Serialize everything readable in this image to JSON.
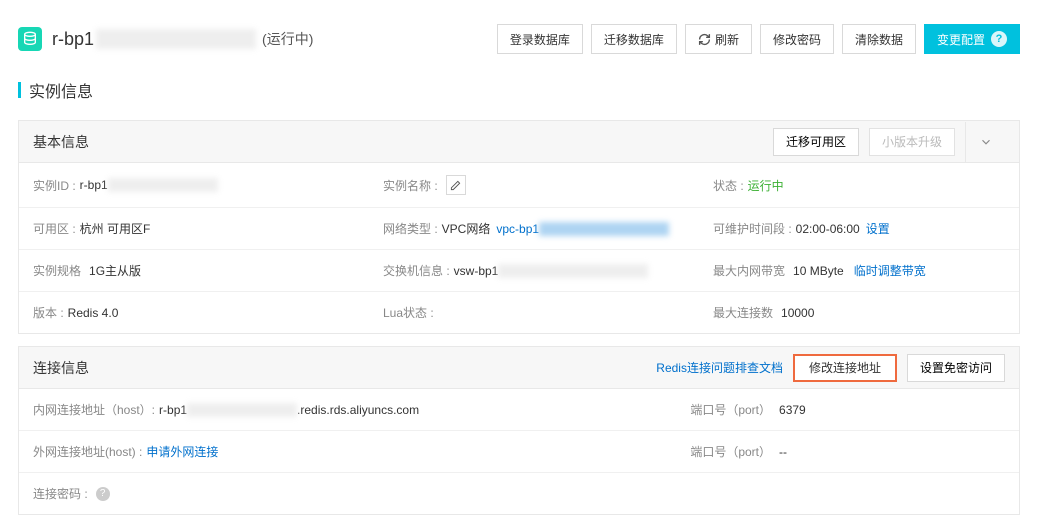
{
  "header": {
    "prefix": "r-bp1",
    "status": "(运行中)",
    "buttons": {
      "login_db": "登录数据库",
      "migrate_db": "迁移数据库",
      "refresh": "刷新",
      "change_pwd": "修改密码",
      "clear_data": "清除数据",
      "change_spec": "变更配置"
    }
  },
  "section": {
    "instance_info": "实例信息"
  },
  "basic": {
    "title": "基本信息",
    "migrate_zone": "迁移可用区",
    "minor_upgrade": "小版本升级",
    "instance_id_label": "实例ID :",
    "instance_id_prefix": "r-bp1",
    "instance_name_label": "实例名称 :",
    "status_label": "状态 :",
    "status_value": "运行中",
    "zone_label": "可用区 :",
    "zone_value": "杭州 可用区F",
    "net_type_label": "网络类型 :",
    "net_type_value": "VPC网络",
    "vpc_prefix": "vpc-bp1",
    "maint_label": "可维护时间段 :",
    "maint_value": "02:00-06:00",
    "maint_set": "设置",
    "spec_label": "实例规格",
    "spec_value": "1G主从版",
    "vsw_label": "交换机信息 :",
    "vsw_prefix": "vsw-bp1",
    "bw_label": "最大内网带宽",
    "bw_value": "10 MByte",
    "bw_adjust": "临时调整带宽",
    "ver_label": "版本 :",
    "ver_value": "Redis 4.0",
    "lua_label": "Lua状态 :",
    "conn_label": "最大连接数",
    "conn_value": "10000"
  },
  "conn": {
    "title": "连接信息",
    "troubleshoot": "Redis连接问题排查文档",
    "modify_addr": "修改连接地址",
    "pwfree": "设置免密访问",
    "intranet_label": "内网连接地址（host）:",
    "intranet_prefix": "r-bp1",
    "intranet_suffix": ".redis.rds.aliyuncs.com",
    "port_label": "端口号（port）",
    "port_value": "6379",
    "internet_label": "外网连接地址(host) :",
    "apply_internet": "申请外网连接",
    "port2_value": "--",
    "pwd_label": "连接密码 :"
  }
}
